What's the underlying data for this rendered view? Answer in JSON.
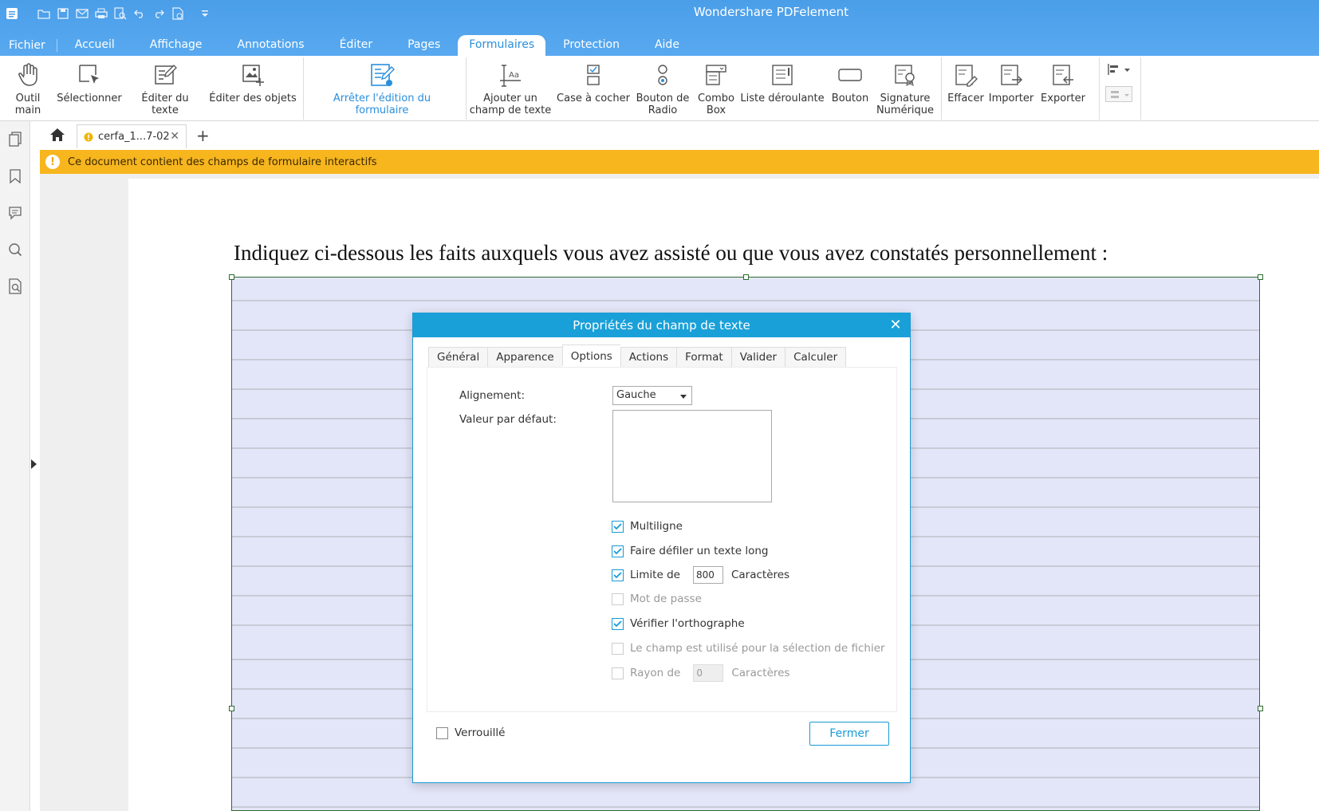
{
  "app": {
    "title": "Wondershare PDFelement"
  },
  "menu": {
    "items": [
      "Fichier",
      "Accueil",
      "Affichage",
      "Annotations",
      "Éditer",
      "Pages",
      "Formulaires",
      "Protection",
      "Aide"
    ],
    "active": "Formulaires"
  },
  "ribbon": {
    "outil_main": "Outil main",
    "selectionner": "Sélectionner",
    "editer_texte": "Éditer du texte",
    "editer_objets": "Éditer des objets",
    "arreter_edition": "Arrêter l'édition du formulaire",
    "ajouter_champ_1": "Ajouter un",
    "ajouter_champ_2": "champ de texte",
    "case_cocher": "Case à cocher",
    "bouton_radio_1": "Bouton de",
    "bouton_radio_2": "Radio",
    "combo_1": "Combo",
    "combo_2": "Box",
    "liste": "Liste déroulante",
    "bouton": "Bouton",
    "signature_1": "Signature",
    "signature_2": "Numérique",
    "effacer": "Effacer",
    "importer": "Importer",
    "exporter": "Exporter"
  },
  "tabs": {
    "document": "cerfa_1...7-02"
  },
  "notice": {
    "text": "Ce document contient des champs de formulaire interactifs"
  },
  "document": {
    "heading": "Indiquez ci-dessous les faits auxquels vous avez assisté ou que vous avez constatés personnellement :"
  },
  "dialog": {
    "title": "Propriétés du champ de texte",
    "tabs": [
      "Général",
      "Apparence",
      "Options",
      "Actions",
      "Format",
      "Valider",
      "Calculer"
    ],
    "active_tab": "Options",
    "alignment_label": "Alignement:",
    "alignment_value": "Gauche",
    "default_value_label": "Valeur par défaut:",
    "options": {
      "multiligne": {
        "label": "Multiligne",
        "checked": true
      },
      "defiler": {
        "label": "Faire défiler un texte long",
        "checked": true
      },
      "limite": {
        "label": "Limite de",
        "checked": true,
        "value": "800",
        "unit": "Caractères"
      },
      "mot_de_passe": {
        "label": "Mot de passe",
        "checked": false
      },
      "orthographe": {
        "label": "Vérifier l'orthographe",
        "checked": true
      },
      "selection_fichier": {
        "label": "Le champ est utilisé pour la sélection de fichier",
        "checked": false
      },
      "rayon": {
        "label": "Rayon de",
        "checked": false,
        "value": "0",
        "unit": "Caractères"
      }
    },
    "verrouille": "Verrouillé",
    "fermer": "Fermer"
  },
  "colors": {
    "accent": "#1aa0d8",
    "titlebar": "#4a9ee8",
    "notice": "#f7b51e",
    "field": "#e3e6f8"
  }
}
